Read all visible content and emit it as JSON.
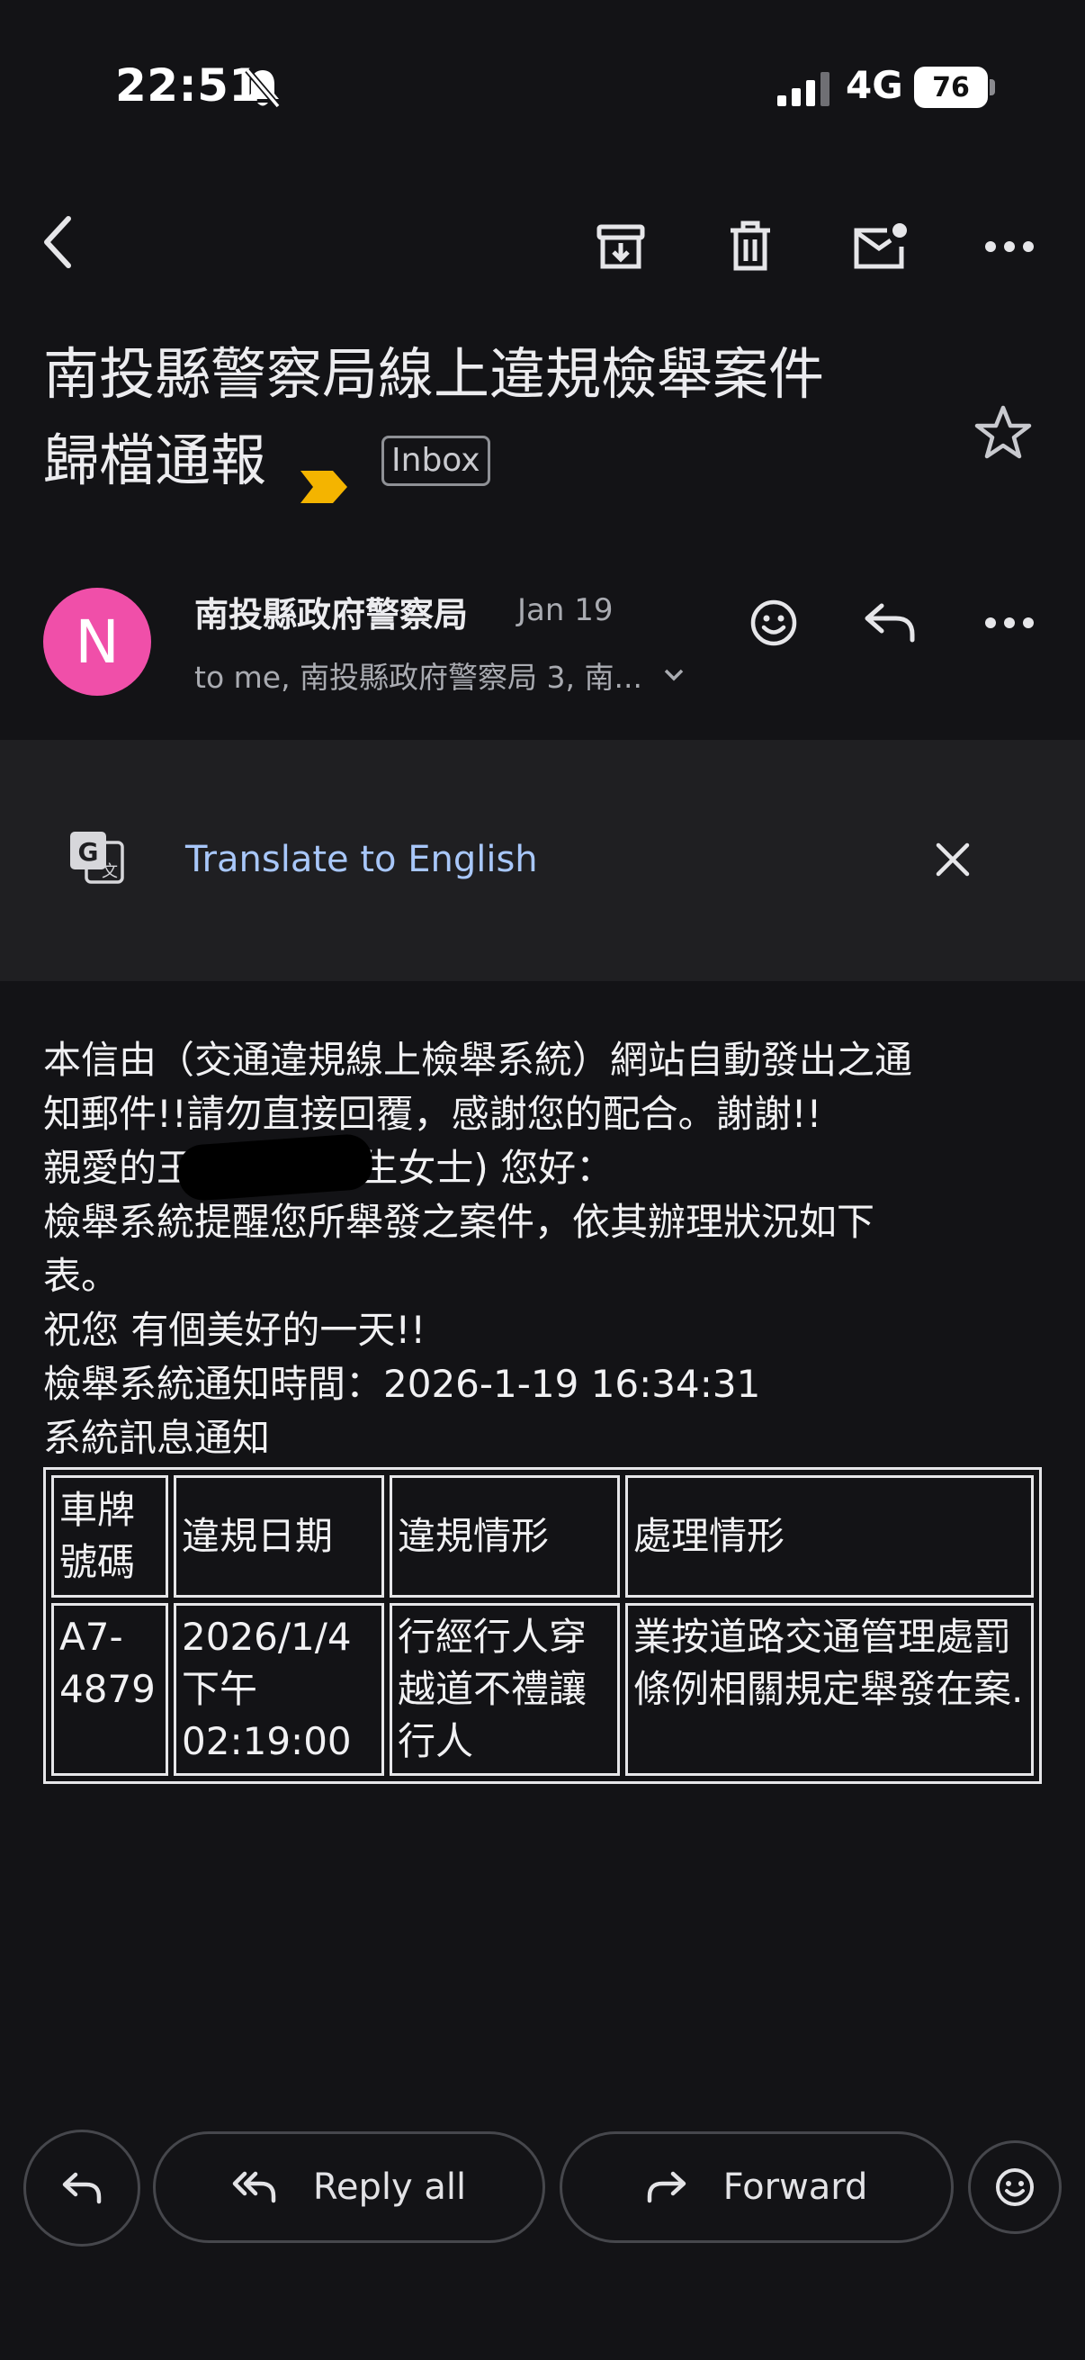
{
  "status_bar": {
    "time": "22:51",
    "network": "4G",
    "battery": "76"
  },
  "email": {
    "subject_line1": "南投縣警察局線上違規檢舉案件",
    "subject_line2": "歸檔通報",
    "label": "Inbox",
    "sender_initial": "N",
    "sender": "南投縣政府警察局",
    "date": "Jan 19",
    "recipients": "to me, 南投縣政府警察局 3, 南..."
  },
  "translate": {
    "link": "Translate to English"
  },
  "body": {
    "paragraph": "本信由（交通違規線上檢舉系統）網站自動發出之通\n知郵件!!請勿直接回覆，感謝您的配合。謝謝!!\n親愛的王　　　(先生女士) 您好：\n檢舉系統提醒您所舉發之案件，依其辦理狀況如下\n表。\n祝您 有個美好的一天!!\n檢舉系統通知時間：2026-1-19 16:34:31\n系統訊息通知",
    "table": {
      "headers": [
        "車牌號碼",
        "違規日期",
        "違規情形",
        "處理情形"
      ],
      "row": [
        "A7-4879",
        "2026/1/4 下午 02:19:00",
        "行經行人穿越道不禮讓行人",
        "業按道路交通管理處罰條例相關規定舉發在案."
      ]
    }
  },
  "actions": {
    "reply_all": "Reply all",
    "forward": "Forward"
  },
  "colors": {
    "background": "#131316",
    "avatar": "#f04fa9",
    "link": "#a8c7fa",
    "important": "#f4b400"
  }
}
